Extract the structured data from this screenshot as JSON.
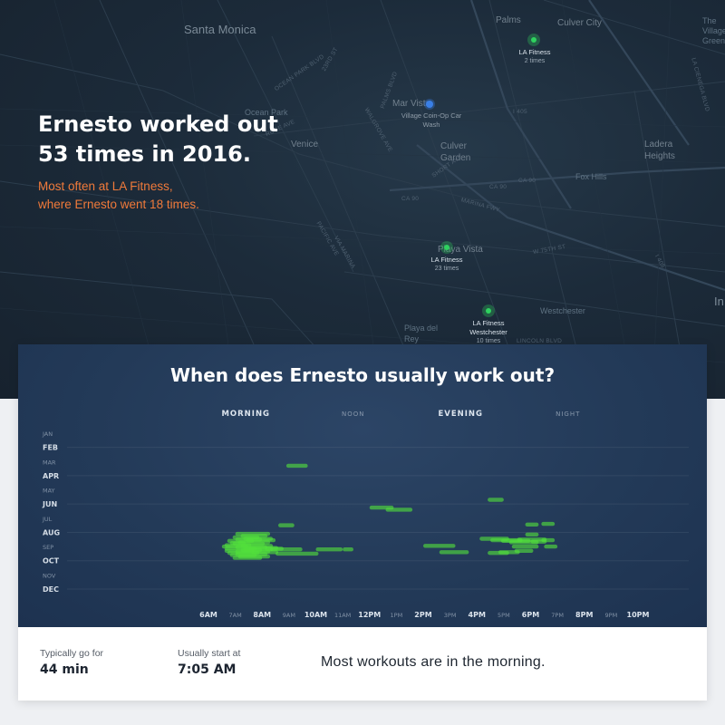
{
  "map": {
    "place_labels": [
      "Santa Monica",
      "Palms",
      "Culver City",
      "The Village Green",
      "Ocean Park",
      "Mar Vista",
      "Venice",
      "Culver Garden",
      "Ladera Heights",
      "Fox Hills",
      "Playa Vista",
      "Westchester",
      "Playa del Rey",
      "In"
    ],
    "road_labels": [
      "OCEAN PARK BLVD",
      "23RD ST",
      "PALMS BLVD",
      "WALGROVE AVE",
      "ROSE AVE",
      "PACIFIC AVE",
      "VIA MARINA",
      "MARINA FWY",
      "SHORT AVE",
      "CA 90",
      "CA 90",
      "CA 90",
      "I 405",
      "W 75TH ST",
      "LINCOLN BLVD",
      "LA CIENEGA BLVD",
      "I 405"
    ],
    "car_wash": "Village Coin-Op Car Wash",
    "pins": [
      {
        "name": "LA Fitness",
        "count": "2 times"
      },
      {
        "name": "LA Fitness",
        "count": "23 times"
      },
      {
        "name": "LA Fitness Westchester",
        "count": "10 times"
      }
    ]
  },
  "headline": {
    "line1": "Ernesto worked out",
    "line2": "53 times in 2016.",
    "sub1": "Most often at LA Fitness,",
    "sub2": "where Ernesto went 18 times."
  },
  "panel": {
    "title": "When does Ernesto usually work out?"
  },
  "chart_data": {
    "type": "scatter",
    "title": "When does Ernesto usually work out?",
    "periods": [
      "MORNING",
      "NOON",
      "EVENING",
      "NIGHT"
    ],
    "y_ticks": [
      "JAN",
      "FEB",
      "MAR",
      "APR",
      "MAY",
      "JUN",
      "JUL",
      "AUG",
      "SEP",
      "OCT",
      "NOV",
      "DEC"
    ],
    "x_ticks": [
      "6AM",
      "7AM",
      "8AM",
      "9AM",
      "10AM",
      "11AM",
      "12PM",
      "1PM",
      "2PM",
      "3PM",
      "4PM",
      "5PM",
      "6PM",
      "7PM",
      "8PM",
      "9PM",
      "10PM"
    ],
    "xlim_hours": [
      6,
      22
    ],
    "ylim_month": [
      1,
      13
    ],
    "bar_color": "#52e03c",
    "workouts": [
      {
        "start": 7.0,
        "end": 8.3,
        "month": 8.1
      },
      {
        "start": 7.2,
        "end": 8.2,
        "month": 8.25
      },
      {
        "start": 6.9,
        "end": 7.9,
        "month": 8.35
      },
      {
        "start": 7.3,
        "end": 8.4,
        "month": 8.45
      },
      {
        "start": 7.0,
        "end": 8.0,
        "month": 8.5
      },
      {
        "start": 7.4,
        "end": 8.5,
        "month": 8.55
      },
      {
        "start": 6.7,
        "end": 7.7,
        "month": 8.6
      },
      {
        "start": 7.1,
        "end": 8.3,
        "month": 8.7
      },
      {
        "start": 6.9,
        "end": 8.1,
        "month": 8.8
      },
      {
        "start": 6.6,
        "end": 7.6,
        "month": 8.9
      },
      {
        "start": 7.2,
        "end": 8.4,
        "month": 8.95
      },
      {
        "start": 6.5,
        "end": 7.5,
        "month": 9.0
      },
      {
        "start": 7.0,
        "end": 8.2,
        "month": 9.05
      },
      {
        "start": 7.5,
        "end": 8.6,
        "month": 9.1
      },
      {
        "start": 6.6,
        "end": 7.8,
        "month": 9.15
      },
      {
        "start": 7.3,
        "end": 8.4,
        "month": 9.2
      },
      {
        "start": 6.6,
        "end": 7.7,
        "month": 9.3
      },
      {
        "start": 7.0,
        "end": 8.3,
        "month": 9.35
      },
      {
        "start": 7.6,
        "end": 8.6,
        "month": 9.4
      },
      {
        "start": 6.7,
        "end": 7.9,
        "month": 9.45
      },
      {
        "start": 7.0,
        "end": 8.2,
        "month": 9.55
      },
      {
        "start": 6.8,
        "end": 7.8,
        "month": 9.6
      },
      {
        "start": 7.1,
        "end": 8.3,
        "month": 9.7
      },
      {
        "start": 6.9,
        "end": 8.0,
        "month": 9.8
      },
      {
        "start": 7.2,
        "end": 8.0,
        "month": 9.25
      },
      {
        "start": 6.8,
        "end": 7.4,
        "month": 8.75
      },
      {
        "start": 8.1,
        "end": 8.8,
        "month": 9.15
      },
      {
        "start": 8.3,
        "end": 9.5,
        "month": 9.2
      },
      {
        "start": 8.5,
        "end": 10.1,
        "month": 9.5
      },
      {
        "start": 8.6,
        "end": 9.2,
        "month": 7.5
      },
      {
        "start": 8.9,
        "end": 9.7,
        "month": 3.3
      },
      {
        "start": 10.0,
        "end": 11.0,
        "month": 9.2
      },
      {
        "start": 11.0,
        "end": 11.4,
        "month": 9.2
      },
      {
        "start": 12.0,
        "end": 12.9,
        "month": 6.25
      },
      {
        "start": 12.6,
        "end": 13.6,
        "month": 6.4
      },
      {
        "start": 14.0,
        "end": 15.2,
        "month": 8.95
      },
      {
        "start": 14.6,
        "end": 15.7,
        "month": 9.4
      },
      {
        "start": 16.4,
        "end": 17.0,
        "month": 5.7
      },
      {
        "start": 16.1,
        "end": 17.2,
        "month": 8.45
      },
      {
        "start": 16.5,
        "end": 17.7,
        "month": 8.55
      },
      {
        "start": 16.9,
        "end": 18.0,
        "month": 8.6
      },
      {
        "start": 17.2,
        "end": 18.3,
        "month": 8.7
      },
      {
        "start": 17.5,
        "end": 18.6,
        "month": 8.5
      },
      {
        "start": 17.3,
        "end": 18.3,
        "month": 9.0
      },
      {
        "start": 17.4,
        "end": 18.1,
        "month": 9.3
      },
      {
        "start": 16.8,
        "end": 17.6,
        "month": 9.4
      },
      {
        "start": 16.4,
        "end": 17.2,
        "month": 9.45
      },
      {
        "start": 17.8,
        "end": 18.3,
        "month": 8.15
      },
      {
        "start": 17.8,
        "end": 18.3,
        "month": 7.45
      },
      {
        "start": 18.4,
        "end": 18.9,
        "month": 7.4
      },
      {
        "start": 18.4,
        "end": 18.9,
        "month": 8.55
      },
      {
        "start": 18.5,
        "end": 19.0,
        "month": 9.0
      },
      {
        "start": 18.0,
        "end": 18.6,
        "month": 8.65
      }
    ]
  },
  "stats": {
    "duration_label": "Typically go for",
    "duration_value": "44 min",
    "start_label": "Usually start at",
    "start_value": "7:05 AM",
    "summary": "Most workouts are in the morning."
  }
}
